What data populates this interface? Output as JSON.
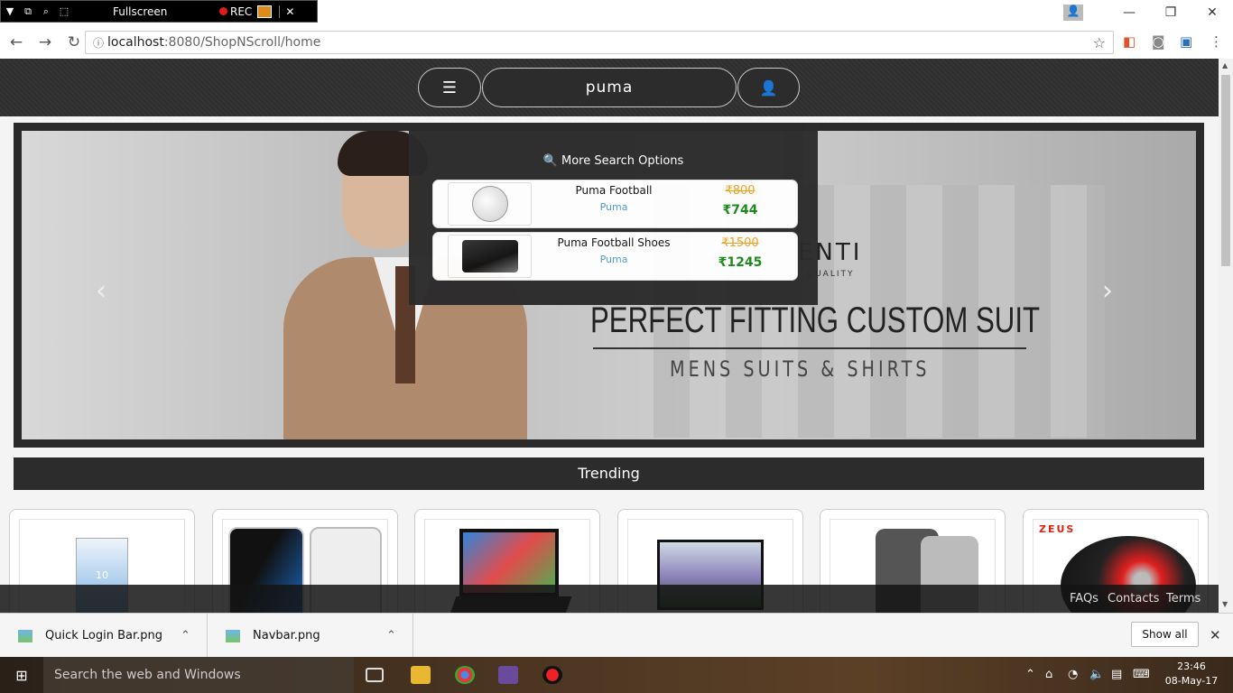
{
  "recorder": {
    "title": "Fullscreen",
    "rec_label": "REC"
  },
  "browser": {
    "url_host": "localhost",
    "url_path": ":8080/ShopNScroll/home"
  },
  "site": {
    "search_value": "puma",
    "search_options_label": "More Search Options",
    "results": [
      {
        "name": "Puma Football",
        "brand": "Puma",
        "old_price": "₹800",
        "new_price": "₹744"
      },
      {
        "name": "Puma Football Shoes",
        "brand": "Puma",
        "old_price": "₹1500",
        "new_price": "₹1245"
      }
    ],
    "slide": {
      "brand": "ENTI",
      "quality": "QUALITY",
      "title": "PERFECT FITTING CUSTOM SUIT",
      "subtitle": "MENS SUITS & SHIRTS"
    },
    "trending_label": "Trending",
    "card_texts": {
      "phone_time": "10",
      "helmet_brand": "ZEUS"
    },
    "footer": {
      "faqs": "FAQs",
      "contacts": "Contacts",
      "terms": "Terms"
    }
  },
  "downloads": {
    "files": [
      {
        "name": "Quick Login Bar.png"
      },
      {
        "name": "Navbar.png"
      }
    ],
    "show_all": "Show all"
  },
  "taskbar": {
    "search_placeholder": "Search the web and Windows",
    "time": "23:46",
    "date": "08-May-17"
  }
}
